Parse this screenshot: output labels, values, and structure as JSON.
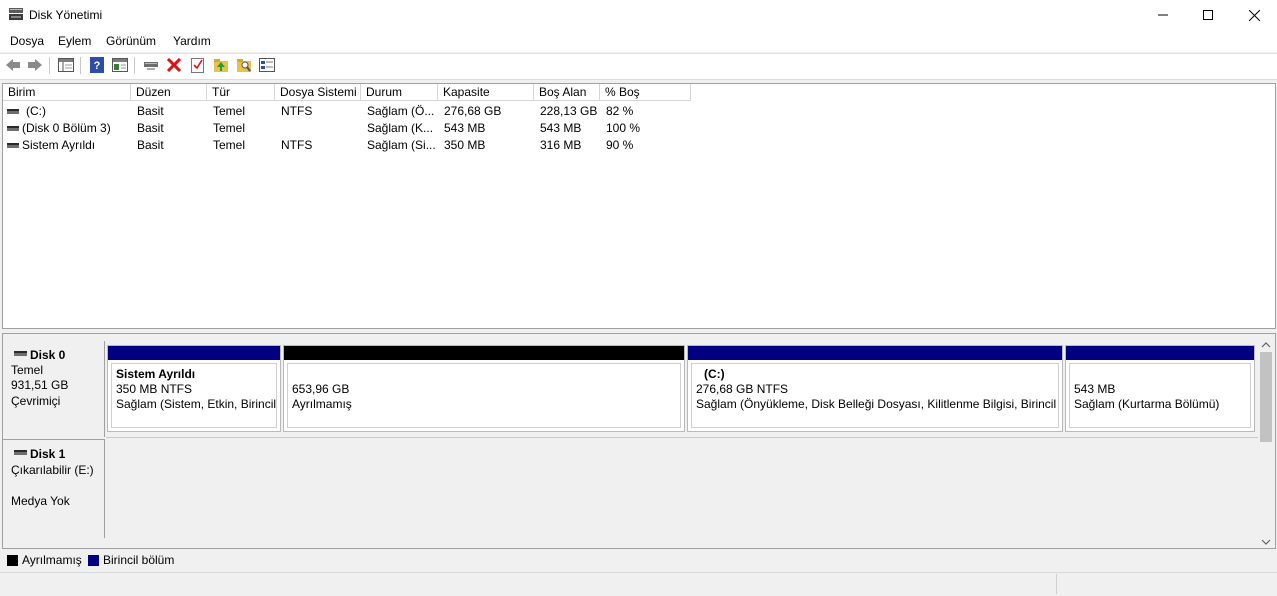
{
  "window": {
    "title": "Disk Yönetimi",
    "controls": {
      "minimize": "—",
      "maximize": "☐",
      "close": "✕"
    }
  },
  "menu": [
    "Dosya",
    "Eylem",
    "Görünüm",
    "Yardım"
  ],
  "toolbar_icons": [
    "back-arrow-icon",
    "forward-arrow-icon",
    "properties-list-icon",
    "help-icon",
    "view-icon",
    "connect-icon",
    "delete-icon",
    "check-icon",
    "up-folder-icon",
    "search-folder-icon",
    "disk-view-icon"
  ],
  "columns": [
    "Birim",
    "Düzen",
    "Tür",
    "Dosya Sistemi",
    "Durum",
    "Kapasite",
    "Boş Alan",
    "% Boş"
  ],
  "volumes": [
    {
      "birim": "(C:)",
      "duzen": "Basit",
      "tur": "Temel",
      "dosya_sistemi": "NTFS",
      "durum": "Sağlam (Ö...",
      "kapasite": "276,68 GB",
      "bos_alan": "228,13 GB",
      "yuzde_bos": "82 %"
    },
    {
      "birim": "(Disk 0 Bölüm 3)",
      "duzen": "Basit",
      "tur": "Temel",
      "dosya_sistemi": "",
      "durum": "Sağlam (K...",
      "kapasite": "543 MB",
      "bos_alan": "543 MB",
      "yuzde_bos": "100 %"
    },
    {
      "birim": "Sistem Ayrıldı",
      "duzen": "Basit",
      "tur": "Temel",
      "dosya_sistemi": "NTFS",
      "durum": "Sağlam (Si...",
      "kapasite": "350 MB",
      "bos_alan": "316 MB",
      "yuzde_bos": "90 %"
    }
  ],
  "disks": [
    {
      "name": "Disk 0",
      "type": "Temel",
      "size": "931,51 GB",
      "status": "Çevrimiçi",
      "partitions": [
        {
          "title": "Sistem Ayrıldı",
          "line1": "350 MB NTFS",
          "line2": "Sağlam (Sistem, Etkin, Birincil Bölüm)",
          "kind": "primary"
        },
        {
          "title": "",
          "line1": "653,96 GB",
          "line2": "Ayrılmamış",
          "kind": "unallocated"
        },
        {
          "title": "(C:)",
          "line1": "276,68 GB NTFS",
          "line2": "Sağlam (Önyükleme, Disk Belleği Dosyası, Kilitlenme Bilgisi, Birincil bölüm)",
          "kind": "primary"
        },
        {
          "title": "",
          "line1": "543 MB",
          "line2": "Sağlam (Kurtarma Bölümü)",
          "kind": "primary"
        }
      ]
    },
    {
      "name": "Disk 1",
      "type": "Çıkarılabilir (E:)",
      "size": "",
      "status": "Medya Yok"
    }
  ],
  "legend": [
    {
      "label": "Ayrılmamış",
      "color": "#000000"
    },
    {
      "label": "Birincil bölüm",
      "color": "#000080"
    }
  ],
  "colors": {
    "primary": "#000080",
    "unallocated": "#000000"
  }
}
